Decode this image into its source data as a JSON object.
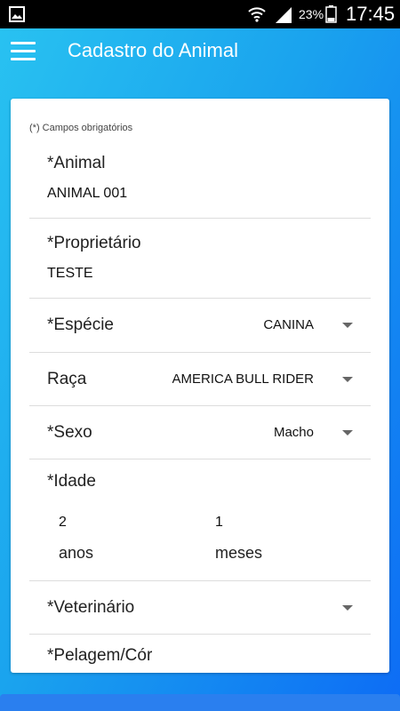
{
  "status_bar": {
    "battery_percent": "23%",
    "time": "17:45"
  },
  "app_bar": {
    "title": "Cadastro do Animal"
  },
  "form": {
    "required_note": "(*) Campos obrigatórios",
    "animal": {
      "label": "*Animal",
      "value": "ANIMAL 001"
    },
    "owner": {
      "label": "*Proprietário",
      "value": "TESTE"
    },
    "species": {
      "label": "*Espécie",
      "value": "CANINA"
    },
    "breed": {
      "label": "Raça",
      "value": "AMERICA BULL RIDER"
    },
    "sex": {
      "label": "*Sexo",
      "value": "Macho"
    },
    "age": {
      "label": "*Idade",
      "years_value": "2",
      "years_unit": "anos",
      "months_value": "1",
      "months_unit": "meses"
    },
    "vet": {
      "label": "*Veterinário",
      "value": ""
    },
    "next_label": "*Pelagem/Cór"
  },
  "colors": {
    "primary": "#1aa3ee",
    "status_bar": "#000000"
  }
}
